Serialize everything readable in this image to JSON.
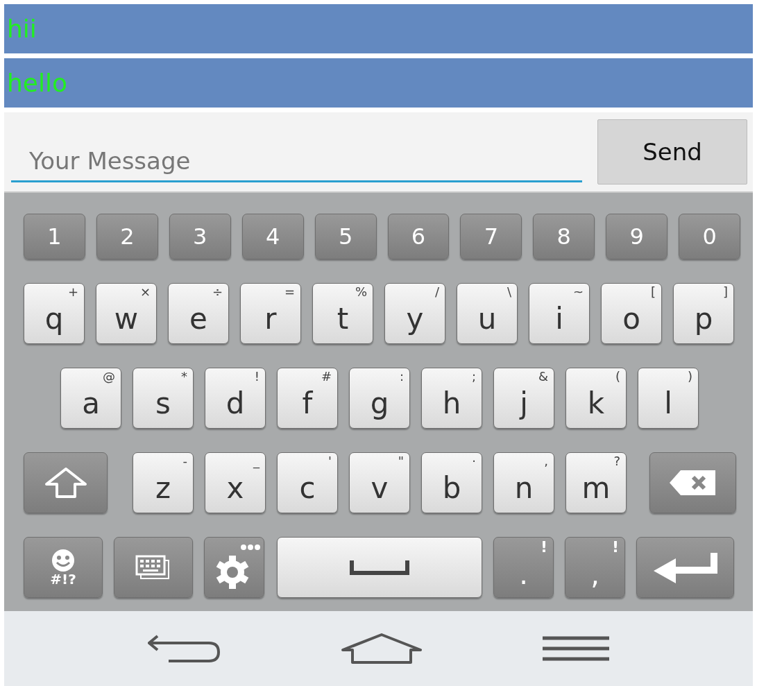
{
  "messages": [
    {
      "text": "hii"
    },
    {
      "text": "hello"
    }
  ],
  "composer": {
    "placeholder": "Your Message",
    "send_button": "Send"
  },
  "keyboard": {
    "rows": [
      {
        "keys": [
          {
            "kind": "number",
            "label": "1"
          },
          {
            "kind": "number",
            "label": "2"
          },
          {
            "kind": "number",
            "label": "3"
          },
          {
            "kind": "number",
            "label": "4"
          },
          {
            "kind": "number",
            "label": "5"
          },
          {
            "kind": "number",
            "label": "6"
          },
          {
            "kind": "number",
            "label": "7"
          },
          {
            "kind": "number",
            "label": "8"
          },
          {
            "kind": "number",
            "label": "9"
          },
          {
            "kind": "number",
            "label": "0"
          }
        ]
      },
      {
        "keys": [
          {
            "kind": "letter",
            "label": "q",
            "hint": "+"
          },
          {
            "kind": "letter",
            "label": "w",
            "hint": "×"
          },
          {
            "kind": "letter",
            "label": "e",
            "hint": "÷"
          },
          {
            "kind": "letter",
            "label": "r",
            "hint": "="
          },
          {
            "kind": "letter",
            "label": "t",
            "hint": "%"
          },
          {
            "kind": "letter",
            "label": "y",
            "hint": "/"
          },
          {
            "kind": "letter",
            "label": "u",
            "hint": "\\"
          },
          {
            "kind": "letter",
            "label": "i",
            "hint": "~"
          },
          {
            "kind": "letter",
            "label": "o",
            "hint": "["
          },
          {
            "kind": "letter",
            "label": "p",
            "hint": "]"
          }
        ]
      },
      {
        "keys": [
          {
            "kind": "letter",
            "label": "a",
            "hint": "@"
          },
          {
            "kind": "letter",
            "label": "s",
            "hint": "*"
          },
          {
            "kind": "letter",
            "label": "d",
            "hint": "!"
          },
          {
            "kind": "letter",
            "label": "f",
            "hint": "#"
          },
          {
            "kind": "letter",
            "label": "g",
            "hint": ":"
          },
          {
            "kind": "letter",
            "label": "h",
            "hint": ";"
          },
          {
            "kind": "letter",
            "label": "j",
            "hint": "&"
          },
          {
            "kind": "letter",
            "label": "k",
            "hint": "("
          },
          {
            "kind": "letter",
            "label": "l",
            "hint": ")"
          }
        ]
      },
      {
        "keys": [
          {
            "kind": "shift"
          },
          {
            "kind": "letter",
            "label": "z",
            "hint": "-"
          },
          {
            "kind": "letter",
            "label": "x",
            "hint": "_"
          },
          {
            "kind": "letter",
            "label": "c",
            "hint": "'"
          },
          {
            "kind": "letter",
            "label": "v",
            "hint": "\""
          },
          {
            "kind": "letter",
            "label": "b",
            "hint": "·"
          },
          {
            "kind": "letter",
            "label": "n",
            "hint": ","
          },
          {
            "kind": "letter",
            "label": "m",
            "hint": "?"
          },
          {
            "kind": "backspace"
          }
        ]
      },
      {
        "keys": [
          {
            "kind": "symbols",
            "label": "#!?"
          },
          {
            "kind": "layout"
          },
          {
            "kind": "settings"
          },
          {
            "kind": "space"
          },
          {
            "kind": "punct",
            "label": ".",
            "hint": "!"
          },
          {
            "kind": "punct",
            "label": ",",
            "hint": "!"
          },
          {
            "kind": "enter"
          }
        ]
      }
    ]
  }
}
